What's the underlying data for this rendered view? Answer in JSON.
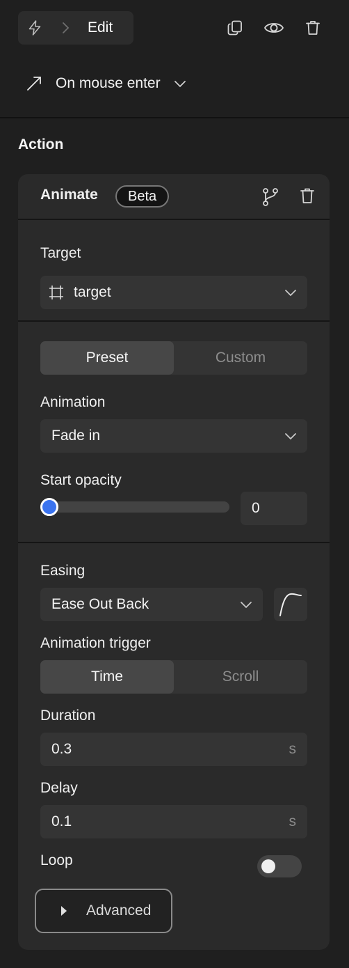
{
  "toolbar": {
    "breadcrumb_label": "Edit",
    "icons": [
      "bolt-icon",
      "chevron-right-icon",
      "duplicate-icon",
      "eye-icon",
      "trash-icon"
    ]
  },
  "trigger": {
    "label": "On mouse enter",
    "icon": "cursor-arrow-icon"
  },
  "section": {
    "title": "Action"
  },
  "card": {
    "title": "Animate",
    "badge": "Beta",
    "target": {
      "label": "Target",
      "value": "target"
    },
    "mode": {
      "options": [
        "Preset",
        "Custom"
      ],
      "selected": "Preset"
    },
    "animation": {
      "label": "Animation",
      "value": "Fade in"
    },
    "start_opacity": {
      "label": "Start opacity",
      "value": "0",
      "level": 0
    },
    "easing": {
      "label": "Easing",
      "value": "Ease Out Back"
    },
    "animation_trigger": {
      "label": "Animation trigger",
      "options": [
        "Time",
        "Scroll"
      ],
      "selected": "Time"
    },
    "duration": {
      "label": "Duration",
      "value": "0.3",
      "unit": "s"
    },
    "delay": {
      "label": "Delay",
      "value": "0.1",
      "unit": "s"
    },
    "loop": {
      "label": "Loop",
      "enabled": false
    },
    "advanced": {
      "label": "Advanced"
    }
  },
  "colors": {
    "background": "#1f1f1f",
    "card": "#2a2a2a",
    "accent": "#3a73ef"
  }
}
